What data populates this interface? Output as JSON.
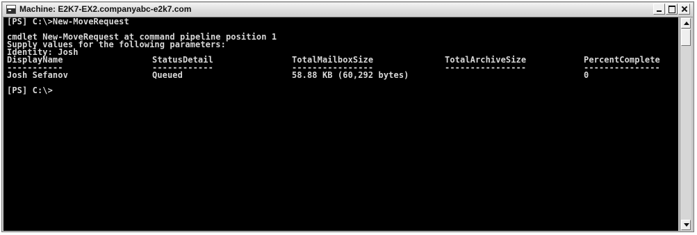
{
  "window": {
    "title": "Machine: E2K7-EX2.companyabc-e2k7.com",
    "icons": {
      "app": "console-icon",
      "minimize": "minimize-icon",
      "maximize": "maximize-icon",
      "close": "close-icon",
      "scroll_up": "chevron-up-icon",
      "scroll_down": "chevron-down-icon"
    }
  },
  "console": {
    "prompt_command": "[PS] C:\\>New-MoveRequest",
    "cmdlet_line": "cmdlet New-MoveRequest at command pipeline position 1",
    "supply_line": "Supply values for the following parameters:",
    "identity_line": "Identity: Josh",
    "table": {
      "headers": [
        "DisplayName",
        "StatusDetail",
        "TotalMailboxSize",
        "TotalArchiveSize",
        "PercentComplete"
      ],
      "separators": [
        "-----------",
        "------------",
        "----------------",
        "----------------",
        "---------------"
      ],
      "rows": [
        [
          "Josh Sefanov",
          "Queued",
          "58.88 KB (60,292 bytes)",
          "",
          "0"
        ]
      ]
    },
    "final_prompt": "[PS] C:\\>"
  }
}
